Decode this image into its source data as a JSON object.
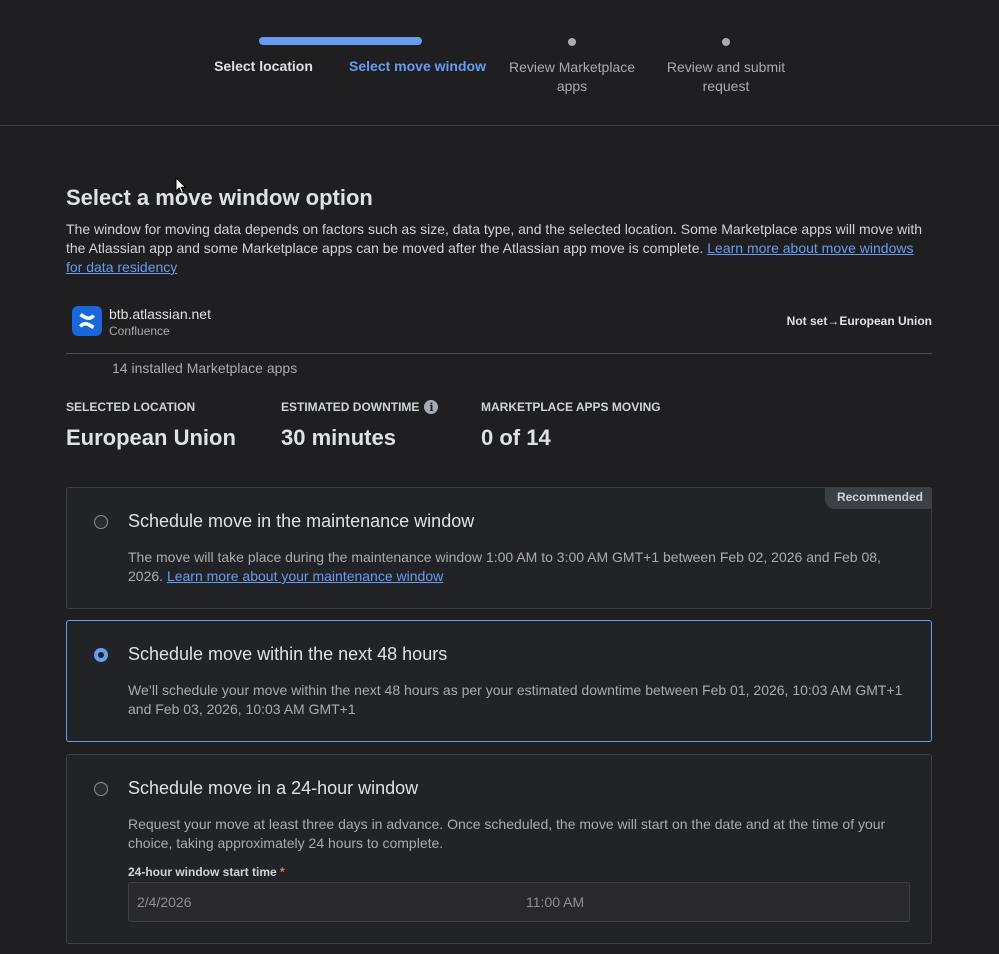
{
  "stepper": {
    "steps": [
      {
        "label": "Select location",
        "state": "done"
      },
      {
        "label": "Select move window",
        "state": "current"
      },
      {
        "label": "Review Marketplace apps",
        "state": "future"
      },
      {
        "label": "Review and submit request",
        "state": "future"
      }
    ]
  },
  "page": {
    "title": "Select a move window option",
    "intro_text": "The window for moving data depends on factors such as size, data type, and the selected location. Some Marketplace apps will move with the Atlassian app and some Marketplace apps can be moved after the Atlassian app move is complete. ",
    "intro_link": "Learn more about move windows for data residency"
  },
  "site": {
    "name": "btb.atlassian.net",
    "product": "Confluence",
    "icon": "confluence-icon",
    "move_from": "Not set",
    "move_arrow": "→",
    "move_to": "European Union",
    "installed_apps": "14 installed Marketplace apps"
  },
  "stats": {
    "location_label": "SELECTED LOCATION",
    "location_value": "European Union",
    "downtime_label": "ESTIMATED DOWNTIME",
    "downtime_value": "30 minutes",
    "apps_label": "MARKETPLACE APPS MOVING",
    "apps_value": "0 of 14"
  },
  "options": {
    "maintenance": {
      "badge": "Recommended",
      "title": "Schedule move in the maintenance window",
      "desc": "The move will take place during the maintenance window 1:00 AM to 3:00 AM GMT+1 between Feb 02, 2026 and Feb 08, 2026. ",
      "link": "Learn more about your maintenance window",
      "selected": false
    },
    "next48": {
      "title": "Schedule move within the next 48 hours",
      "desc": "We’ll schedule your move within the next 48 hours as per your estimated downtime between Feb 01, 2026, 10:03 AM GMT+1 and Feb 03, 2026, 10:03 AM GMT+1",
      "selected": true
    },
    "window24": {
      "title": "Schedule move in a 24-hour window",
      "desc": "Request your move at least three days in advance. Once scheduled, the move will start on the date and at the time of your choice, taking approximately 24 hours to complete.",
      "field_label": "24-hour window start time",
      "required_mark": "*",
      "date_value": "2/4/2026",
      "time_value": "11:00 AM",
      "selected": false
    }
  },
  "colors": {
    "accent": "#669df1",
    "background": "#1f1f21",
    "confluence_blue": "#1868db"
  }
}
